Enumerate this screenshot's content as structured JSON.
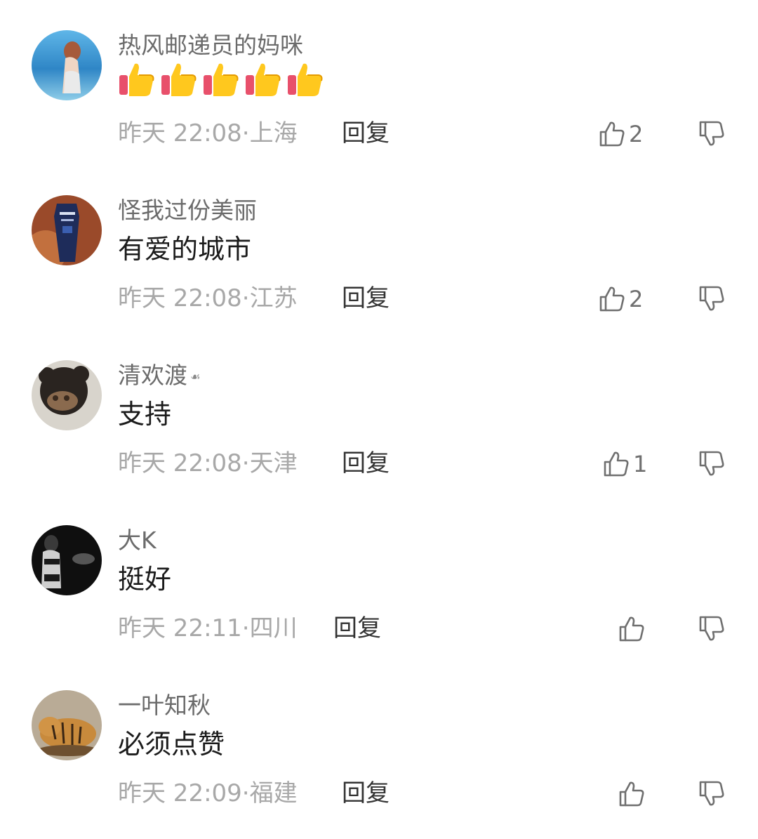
{
  "comments": [
    {
      "username": "热风邮递员的妈咪",
      "content": "",
      "content_emoji": [
        "thumbs-up-icon",
        "thumbs-up-icon",
        "thumbs-up-icon",
        "thumbs-up-icon",
        "thumbs-up-icon"
      ],
      "time": "昨天 22:08",
      "location": "上海",
      "reply_label": "回复",
      "like_count": "2"
    },
    {
      "username": "怪我过份美丽",
      "content": "有爱的城市",
      "time": "昨天 22:08",
      "location": "江苏",
      "reply_label": "回复",
      "like_count": "2"
    },
    {
      "username": "清欢渡",
      "content": "支持",
      "time": "昨天 22:08",
      "location": "天津",
      "reply_label": "回复",
      "like_count": "1"
    },
    {
      "username": "大K",
      "content": "挺好",
      "time": "昨天 22:11",
      "location": "四川",
      "reply_label": "回复",
      "like_count": ""
    },
    {
      "username": "一叶知秋",
      "content": "必须点赞",
      "time": "昨天 22:09",
      "location": "福建",
      "reply_label": "回复",
      "like_count": ""
    }
  ],
  "meta_separator": "·",
  "icons": {
    "like": "thumbs-up-outline-icon",
    "dislike": "thumbs-down-outline-icon",
    "emoji": "thumbs-up-emoji-icon"
  },
  "colors": {
    "username": "#6b6b6b",
    "content": "#1b1b1b",
    "meta": "#a8a8a8",
    "reply": "#333333",
    "icon": "#6f6f6f"
  }
}
